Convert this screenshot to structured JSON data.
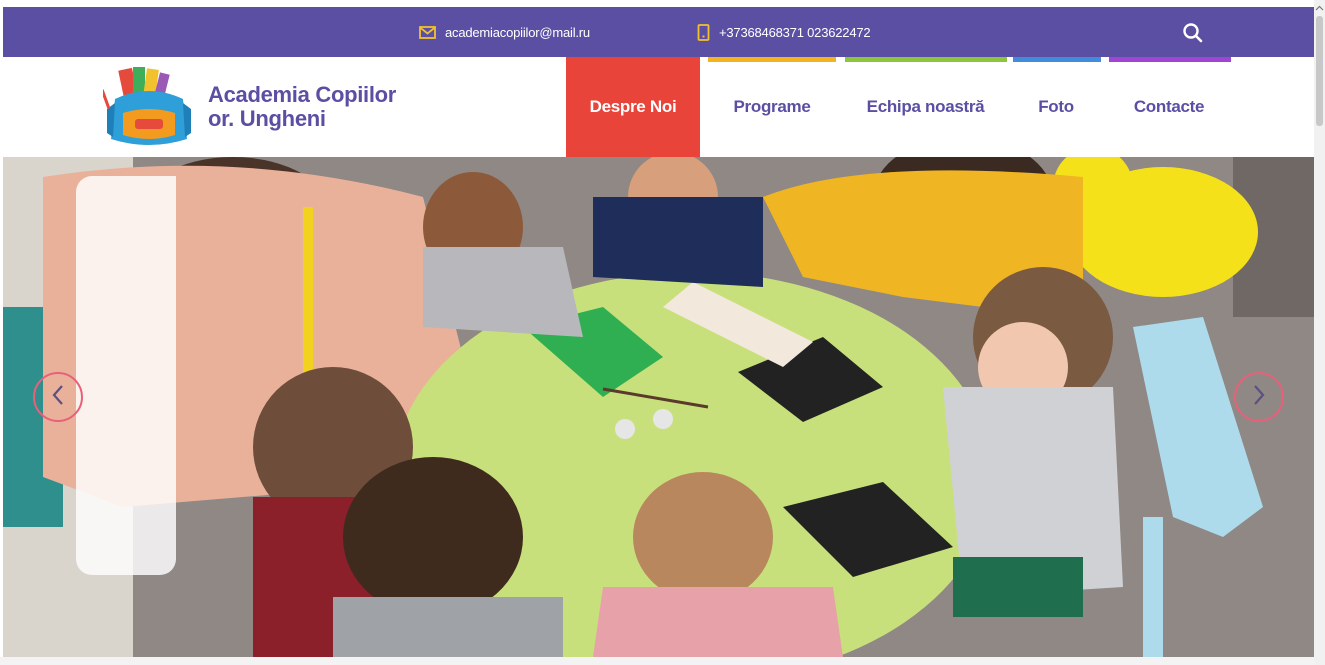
{
  "topbar": {
    "email": "academiacopiilor@mail.ru",
    "phone": "+37368468371 023622472",
    "icons": {
      "email": "envelope-icon",
      "phone": "phone-icon",
      "search": "search-icon"
    },
    "background": "#5b4fa3",
    "icon_color": "#f2c12e"
  },
  "brand": {
    "line1": "Academia Copiilor",
    "line2": "or. Ungheni",
    "logo": "school-backpack-logo",
    "color": "#5b4fa3"
  },
  "nav": {
    "items": [
      {
        "label": "Despre Noi",
        "active": true,
        "color": "#e8443a"
      },
      {
        "label": "Programe",
        "active": false,
        "color": "#f2b51f"
      },
      {
        "label": "Echipa noastră",
        "active": false,
        "color": "#8cc63f"
      },
      {
        "label": "Foto",
        "active": false,
        "color": "#3f8ddb"
      },
      {
        "label": "Contacte",
        "active": false,
        "color": "#a144d4"
      }
    ]
  },
  "hero": {
    "image": "slider-photo-children-crafting-at-table",
    "prev_icon": "chevron-left-icon",
    "next_icon": "chevron-right-icon",
    "arrow_color": "#e8607a"
  }
}
